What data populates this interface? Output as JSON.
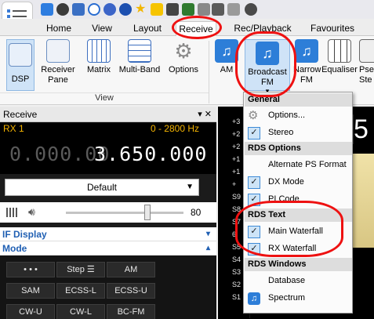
{
  "tabs": [
    "Home",
    "View",
    "Layout",
    "Receive",
    "Rec/Playback",
    "Favourites"
  ],
  "active_tab": "Receive",
  "ribbon": {
    "view_group": {
      "buttons": [
        {
          "label": "DSP"
        },
        {
          "label": "Receiver\nPane"
        },
        {
          "label": "Matrix"
        },
        {
          "label": "Multi-Band"
        },
        {
          "label": "Options"
        }
      ],
      "group_label": "View"
    },
    "demod_buttons": [
      {
        "label": "AM"
      },
      {
        "label": "Broadcast\nFM"
      },
      {
        "label": "Narrow\nFM"
      },
      {
        "label": "Equaliser"
      },
      {
        "label": "Pse\nSte"
      }
    ],
    "dropdown_marker": "▾"
  },
  "receive_panel": {
    "title": "Receive",
    "pin": "▾ ✕",
    "rx_label": "RX 1",
    "bandwidth": "0 - 2800 Hz",
    "freq_dim": "0.000.00",
    "freq_bright": "3.650.000",
    "profile": "Default",
    "volume": 80,
    "volume_label": "80",
    "if_display_label": "IF Display",
    "mode_label": "Mode",
    "mode_buttons": [
      [
        "• • •",
        "Step ☰",
        "AM"
      ],
      [
        "SAM",
        "ECSS-L",
        "ECSS-U"
      ],
      [
        "CW-U",
        "CW-L",
        "BC-FM"
      ]
    ]
  },
  "spectrum": {
    "yaxis": [
      "+3",
      "+2",
      "+2",
      "+1",
      "+1",
      "+",
      "S9",
      "S8",
      "S7",
      "6",
      "S5",
      "S4",
      "S3",
      "S2",
      "S1"
    ]
  },
  "menu": {
    "sections": [
      {
        "header": "General",
        "items": [
          {
            "label": "Options...",
            "icon": "gear-icon",
            "checked": false
          },
          {
            "label": "Stereo",
            "checked": true
          }
        ]
      },
      {
        "header": "RDS Options",
        "items": [
          {
            "label": "Alternate PS Format",
            "checked": false
          },
          {
            "label": "DX Mode",
            "checked": true
          },
          {
            "label": "PI Code",
            "checked": true
          }
        ]
      },
      {
        "header": "RDS Text",
        "items": [
          {
            "label": "Main Waterfall",
            "checked": true
          },
          {
            "label": "RX Waterfall",
            "checked": true
          }
        ]
      },
      {
        "header": "RDS Windows",
        "items": [
          {
            "label": "Database",
            "checked": false
          },
          {
            "label": "Spectrum",
            "icon": "music-note-icon",
            "checked": false
          }
        ]
      }
    ],
    "check_glyph": "✓"
  },
  "colors": {
    "annotation_red": "#e11111",
    "accent_blue": "#1f5fb3",
    "freq_amber": "#f5b400"
  }
}
